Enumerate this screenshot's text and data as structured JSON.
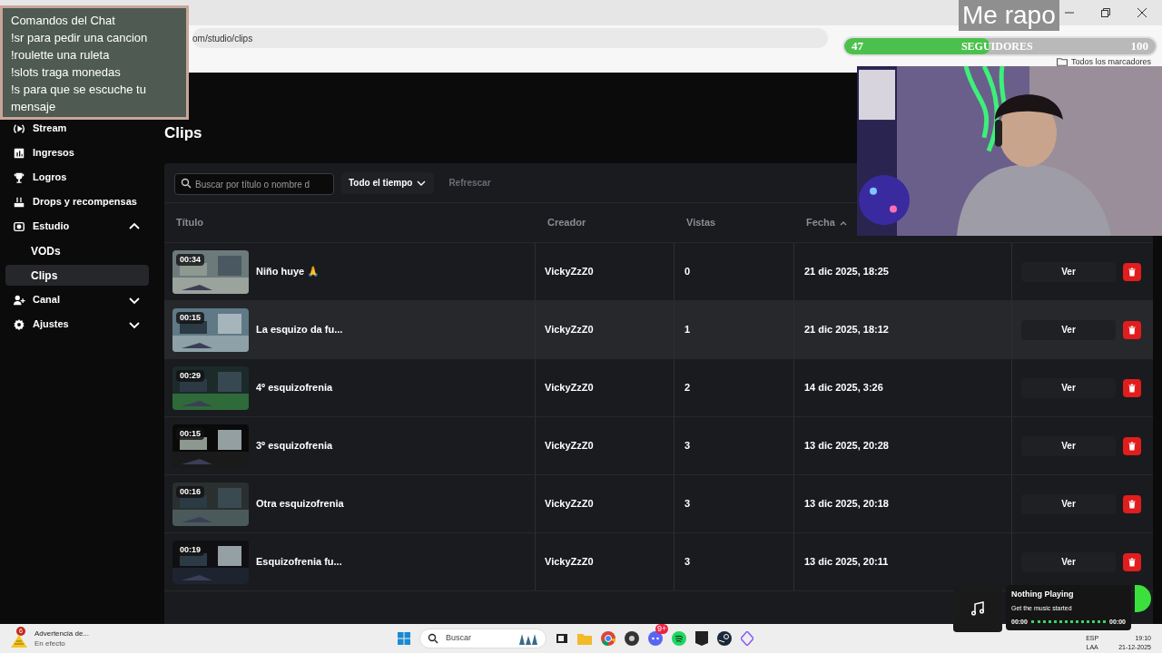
{
  "chat_overlay": {
    "title": "Comandos del Chat",
    "lines": [
      "!sr para pedir una cancion",
      "!roulette una ruleta",
      "!slots traga monedas",
      "!s para que se escuche tu mensaje"
    ]
  },
  "stream_caption": "Me rapo",
  "followers_goal": {
    "current": "47",
    "label": "SEGUIDORES",
    "target": "100",
    "level": 0.47
  },
  "browser": {
    "address": "om/studio/clips",
    "all_bookmarks": "Todos los marcadores"
  },
  "sidebar": {
    "items": [
      {
        "label": "Stream",
        "selected": false
      },
      {
        "label": "Ingresos",
        "selected": false
      },
      {
        "label": "Logros",
        "selected": false
      },
      {
        "label": "Drops y recompensas",
        "selected": false
      },
      {
        "label": "Estudio",
        "selected": false,
        "expanded": true,
        "children": [
          {
            "label": "VODs",
            "selected": false
          },
          {
            "label": "Clips",
            "selected": true
          }
        ]
      },
      {
        "label": "Canal",
        "selected": false,
        "expanded": false
      },
      {
        "label": "Ajustes",
        "selected": false,
        "expanded": false
      }
    ]
  },
  "page": {
    "title": "Clips",
    "search": {
      "placeholder": "Buscar por título o nombre d"
    },
    "period_filter": "Todo el tiempo",
    "refresh": {
      "label": "Refrescar",
      "disabled": true
    }
  },
  "table": {
    "columns": [
      {
        "label": "Título"
      },
      {
        "label": "Creador"
      },
      {
        "label": "Vistas"
      },
      {
        "label": "Fecha",
        "sorted": true
      }
    ],
    "rows": [
      {
        "duration": "00:34",
        "title": "Niño huye 🙏",
        "creator": "VickyZzZ0",
        "views": "0",
        "date": "21 dic 2025, 18:25",
        "action": "Ver",
        "highlighted": false
      },
      {
        "duration": "00:15",
        "title": "La esquizo da fu...",
        "creator": "VickyZzZ0",
        "views": "1",
        "date": "21 dic 2025, 18:12",
        "action": "Ver",
        "highlighted": true
      },
      {
        "duration": "00:29",
        "title": "4º esquizofrenia",
        "creator": "VickyZzZ0",
        "views": "2",
        "date": "14 dic 2025, 3:26",
        "action": "Ver",
        "highlighted": false
      },
      {
        "duration": "00:15",
        "title": "3º esquizofrenia",
        "creator": "VickyZzZ0",
        "views": "3",
        "date": "13 dic 2025, 20:28",
        "action": "Ver",
        "highlighted": false
      },
      {
        "duration": "00:16",
        "title": "Otra esquizofrenia",
        "creator": "VickyZzZ0",
        "views": "3",
        "date": "13 dic 2025, 20:18",
        "action": "Ver",
        "highlighted": false
      },
      {
        "duration": "00:19",
        "title": "Esquizofrenia fu...",
        "creator": "VickyZzZ0",
        "views": "3",
        "date": "13 dic 2025, 20:11",
        "action": "Ver",
        "highlighted": false
      }
    ]
  },
  "music_widget": {
    "title": "Nothing Playing",
    "subtitle": "Get the music started",
    "elapsed": "00:00",
    "total": "00:00"
  },
  "taskbar": {
    "weather": {
      "badge": "6",
      "title": "Advertencia de...",
      "subtitle": "En efecto"
    },
    "search": {
      "placeholder": "Buscar"
    },
    "notification_badge": "9+",
    "language": "ESP",
    "layout": "LAA",
    "time": "19:10",
    "date": "21-12-2025"
  }
}
